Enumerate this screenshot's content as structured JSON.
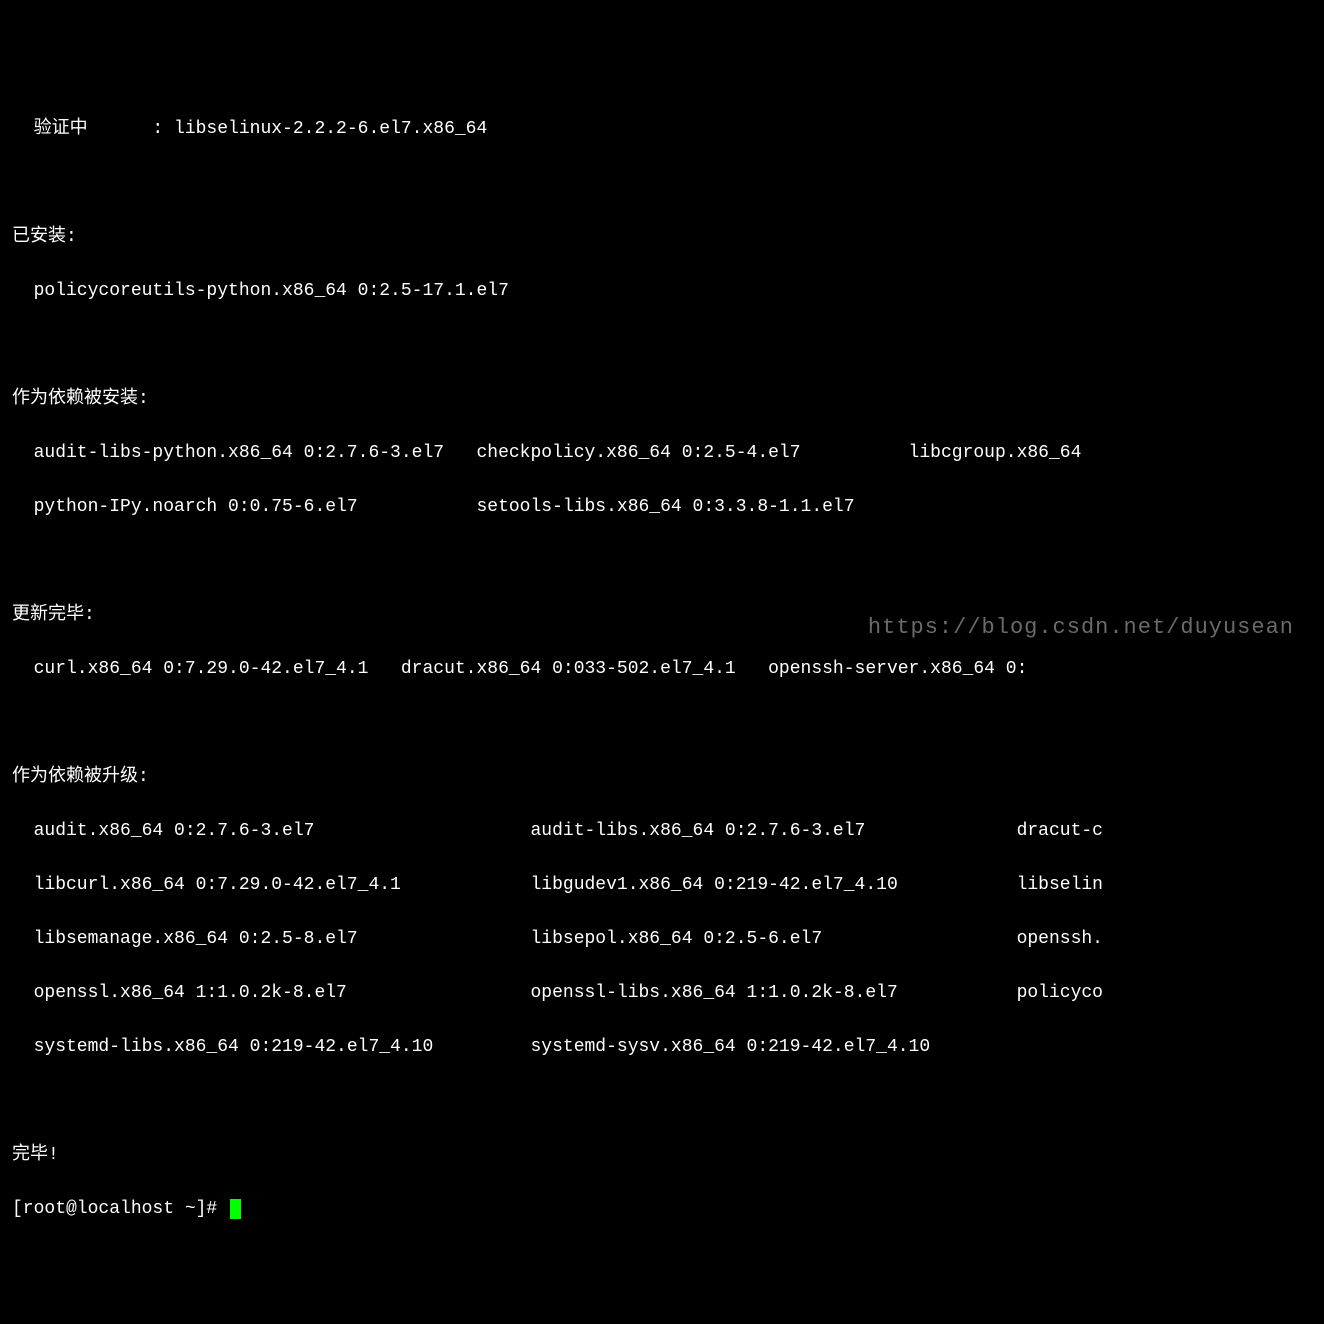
{
  "verify": {
    "label": "  验证中      : ",
    "pkg": "libselinux-2.2.2-6.el7.x86_64"
  },
  "installed": {
    "header": "已安装:",
    "line1": "  policycoreutils-python.x86_64 0:2.5-17.1.el7"
  },
  "deps_installed": {
    "header": "作为依赖被安装:",
    "line1": "  audit-libs-python.x86_64 0:2.7.6-3.el7   checkpolicy.x86_64 0:2.5-4.el7          libcgroup.x86_64",
    "line2": "  python-IPy.noarch 0:0.75-6.el7           setools-libs.x86_64 0:3.3.8-1.1.el7"
  },
  "updated": {
    "header": "更新完毕:",
    "line1": "  curl.x86_64 0:7.29.0-42.el7_4.1   dracut.x86_64 0:033-502.el7_4.1   openssh-server.x86_64 0:"
  },
  "deps_upgraded": {
    "header": "作为依赖被升级:",
    "line1": "  audit.x86_64 0:2.7.6-3.el7                    audit-libs.x86_64 0:2.7.6-3.el7              dracut-c",
    "line2": "  libcurl.x86_64 0:7.29.0-42.el7_4.1            libgudev1.x86_64 0:219-42.el7_4.10           libselin",
    "line3": "  libsemanage.x86_64 0:2.5-8.el7                libsepol.x86_64 0:2.5-6.el7                  openssh.",
    "line4": "  openssl.x86_64 1:1.0.2k-8.el7                 openssl-libs.x86_64 1:1.0.2k-8.el7           policyco",
    "line5": "  systemd-libs.x86_64 0:219-42.el7_4.10         systemd-sysv.x86_64 0:219-42.el7_4.10"
  },
  "done": "完毕!",
  "prompt": "[root@localhost ~]# ",
  "watermark": "https://blog.csdn.net/duyusean"
}
